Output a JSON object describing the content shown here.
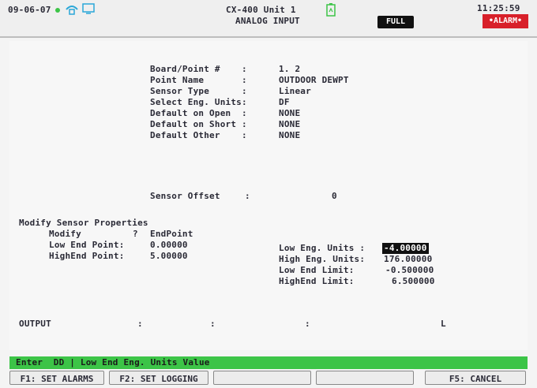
{
  "header": {
    "date": "09-06-07",
    "title_line1": "CX-400 Unit 1",
    "title_line2": "ANALOG INPUT",
    "mode_badge": "FULL",
    "time": "11:25:59",
    "alarm_badge": "•ALARM•"
  },
  "point_info": {
    "board_point_label": "Board/Point #    :",
    "board_point_value": "1. 2",
    "point_name_label": "Point Name       :",
    "point_name_value": "OUTDOOR DEWPT",
    "sensor_type_label": "Sensor Type      :",
    "sensor_type_value": "Linear",
    "select_units_label": "Select Eng. Units:",
    "select_units_value": "DF",
    "default_open_label": "Default on Open  :",
    "default_open_value": "NONE",
    "default_short_label": "Default on Short :",
    "default_short_value": "NONE",
    "default_other_label": "Default Other    :",
    "default_other_value": "NONE"
  },
  "sensor_offset": {
    "label": "Sensor Offset",
    "colon": ":",
    "value": "0"
  },
  "modify": {
    "title": "Modify Sensor Properties",
    "modify_label": "Modify",
    "modify_q": "?",
    "modify_value": "EndPoint",
    "low_end_point_label": "Low End Point:",
    "low_end_point_value": "0.00000",
    "high_end_point_label": "HighEnd Point:",
    "high_end_point_value": "5.00000",
    "low_eng_units_label": "Low Eng. Units :",
    "low_eng_units_value": "-4.00000",
    "high_eng_units_label": "High Eng. Units:",
    "high_eng_units_value": "176.00000",
    "low_end_limit_label": "Low End Limit:",
    "low_end_limit_value": "-0.500000",
    "high_end_limit_label": "HighEnd Limit:",
    "high_end_limit_value": "6.500000"
  },
  "output_row": {
    "label": "OUTPUT",
    "col1": ":",
    "col2": ":",
    "col3": ":",
    "col4": "L"
  },
  "status_bar": {
    "text": "Enter  DD | Low End Eng. Units Value"
  },
  "function_keys": [
    {
      "label": "F1: SET ALARMS"
    },
    {
      "label": "F2: SET LOGGING"
    },
    {
      "label": ""
    },
    {
      "label": ""
    },
    {
      "label": "F5: CANCEL"
    }
  ],
  "colors": {
    "status_green": "#3cc447",
    "alarm_red": "#d8202a"
  }
}
